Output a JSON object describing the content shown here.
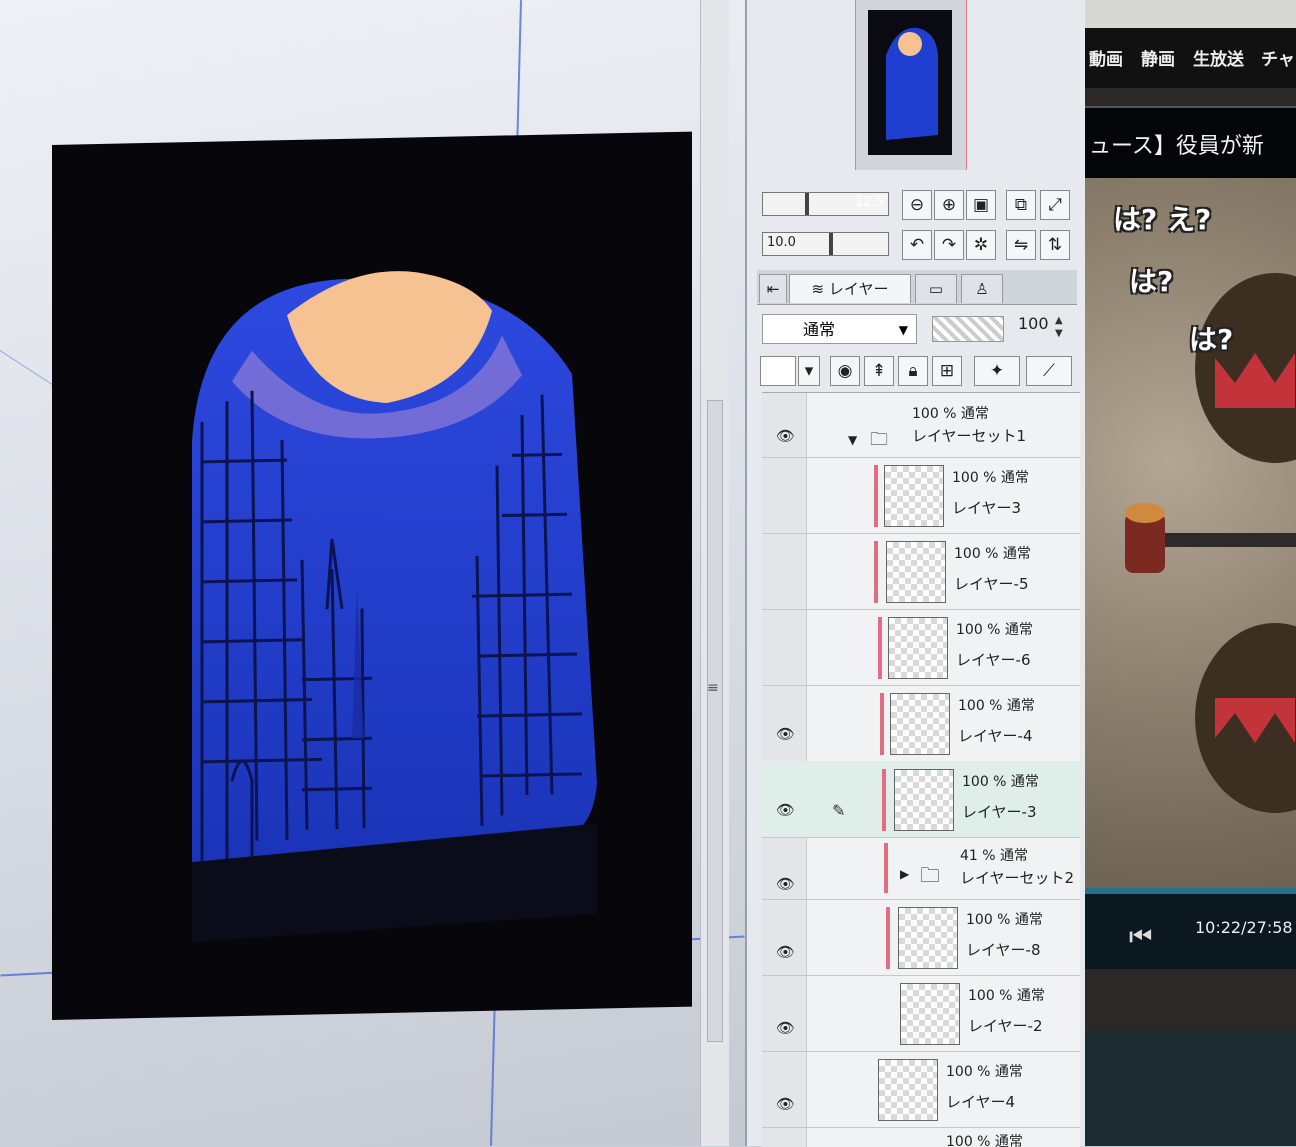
{
  "tools": {
    "brush_size": "12.5",
    "brush_opacity": "10.0",
    "zoom_in_icon": "zoom-in-icon",
    "zoom_out_icon": "zoom-out-icon",
    "fit_icon": "fit-icon",
    "rotate_left_icon": "rotate-left-icon",
    "rotate_right_icon": "rotate-right-icon",
    "reset_icon": "reset-icon",
    "flip_icon": "flip-icon"
  },
  "tabs": [
    {
      "label": "レイヤー",
      "active": true
    }
  ],
  "blend_mode": "通常",
  "opacity": "100",
  "layers": [
    {
      "info": "100 % 通常",
      "name": "レイヤーセット1",
      "type": "folder",
      "visible": true
    },
    {
      "info": "100 % 通常",
      "name": "レイヤー3",
      "type": "layer",
      "visible": false
    },
    {
      "info": "100 % 通常",
      "name": "レイヤー-5",
      "type": "layer",
      "visible": false
    },
    {
      "info": "100 % 通常",
      "name": "レイヤー-6",
      "type": "layer",
      "visible": false
    },
    {
      "info": "100 % 通常",
      "name": "レイヤー-4",
      "type": "layer",
      "visible": true
    },
    {
      "info": "100 % 通常",
      "name": "レイヤー-3",
      "type": "layer",
      "visible": true,
      "selected": true
    },
    {
      "info": "41 % 通常",
      "name": "レイヤーセット2",
      "type": "folder",
      "visible": true
    },
    {
      "info": "100 % 通常",
      "name": "レイヤー-8",
      "type": "layer",
      "visible": true
    },
    {
      "info": "100 % 通常",
      "name": "レイヤー-2",
      "type": "layer",
      "visible": true
    },
    {
      "info": "100 % 通常",
      "name": "レイヤー4",
      "type": "layer",
      "visible": true
    },
    {
      "info": "100 % 通常",
      "name": "",
      "type": "layer",
      "visible": true
    }
  ],
  "browser": {
    "nav": [
      "動画",
      "静画",
      "生放送",
      "チャ"
    ],
    "title": "ュース】役員が新",
    "comments": [
      "は?  え?",
      "は?",
      "は?"
    ],
    "timecode": "10:22/27:58"
  },
  "colors": {
    "sky": "#1f3fd0",
    "moon": "#f6c292",
    "selection_mark": "#e36c84"
  }
}
